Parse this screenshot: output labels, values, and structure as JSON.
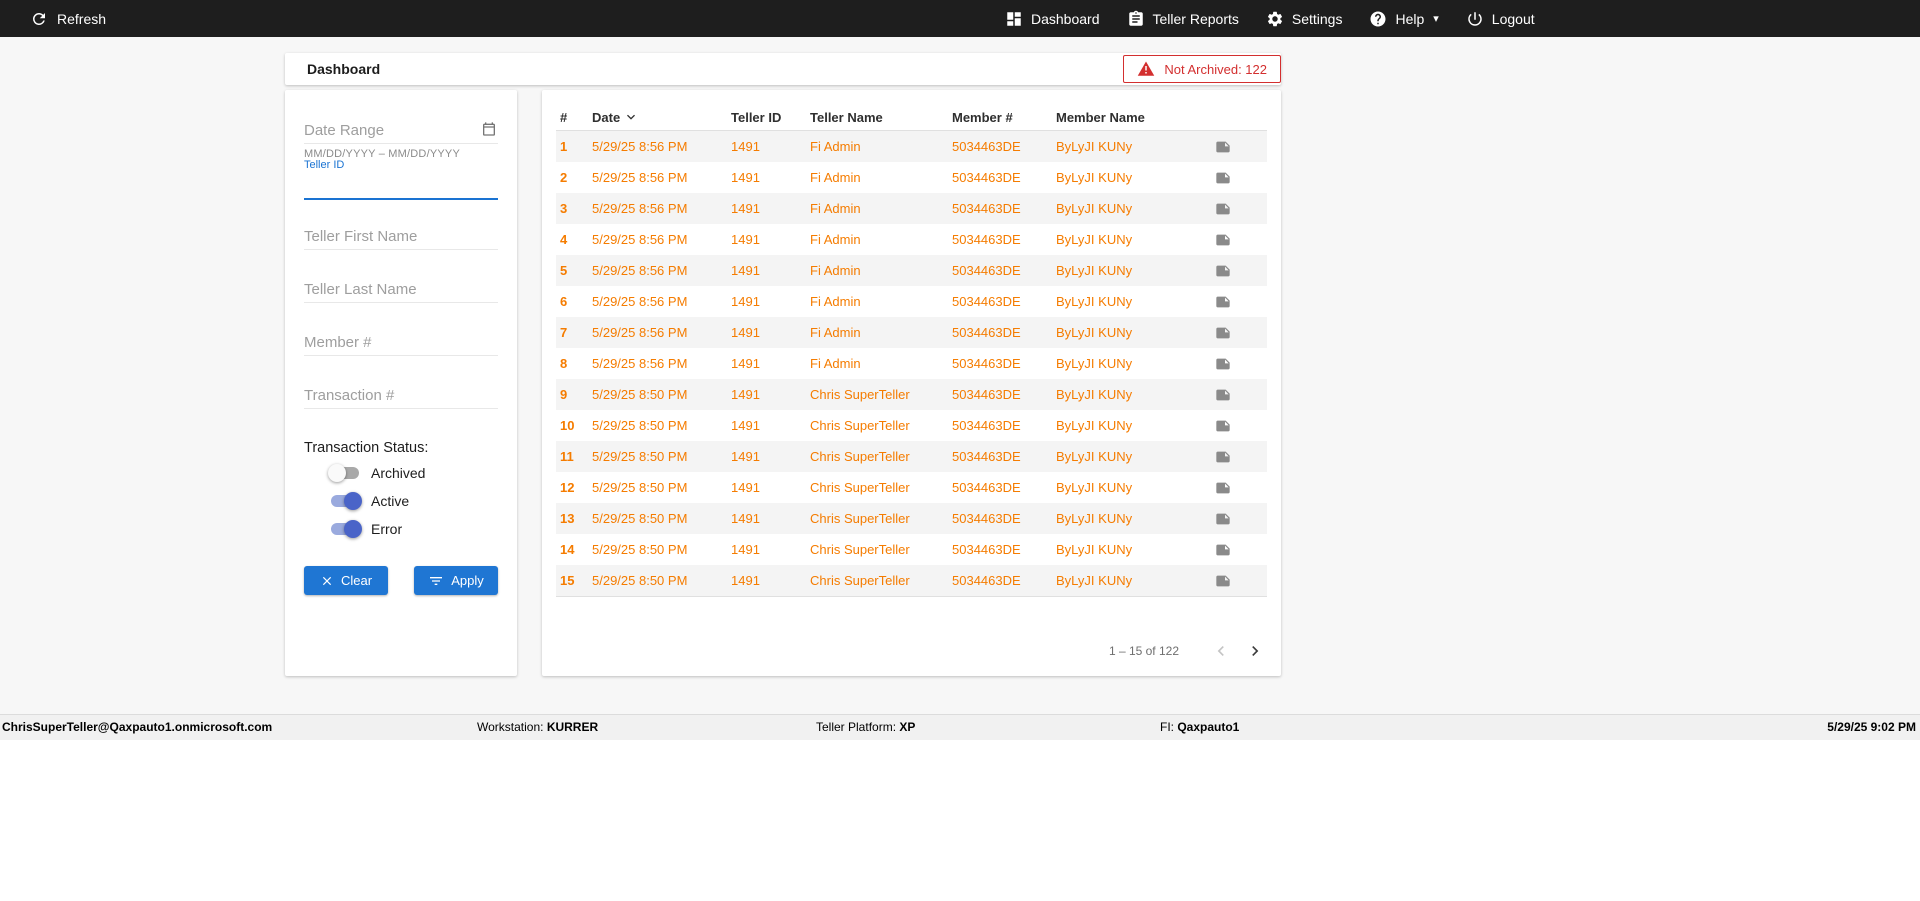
{
  "colors": {
    "topbar_bg": "#1e1e1e",
    "accent_blue": "#1f76d3",
    "row_orange": "#f57c00",
    "alert_red": "#d32f2f",
    "toggle_on_blue": "#4a64c8"
  },
  "topbar": {
    "refresh_label": "Refresh",
    "dashboard_label": "Dashboard",
    "teller_reports_label": "Teller Reports",
    "settings_label": "Settings",
    "help_label": "Help",
    "help_caret": "▾",
    "logout_label": "Logout"
  },
  "header": {
    "title": "Dashboard",
    "not_archived_badge": "Not Archived: 122"
  },
  "filters": {
    "date_range_placeholder": "Date Range",
    "date_range_hint": "MM/DD/YYYY – MM/DD/YYYY",
    "teller_id_label": "Teller ID",
    "teller_first_name_placeholder": "Teller First Name",
    "teller_last_name_placeholder": "Teller Last Name",
    "member_placeholder": "Member #",
    "transaction_placeholder": "Transaction #",
    "status_label": "Transaction Status:",
    "toggles": [
      {
        "label": "Archived",
        "on": false
      },
      {
        "label": "Active",
        "on": true
      },
      {
        "label": "Error",
        "on": true
      }
    ],
    "clear_label": "Clear",
    "apply_label": "Apply"
  },
  "table": {
    "columns": [
      "#",
      "Date",
      "Teller ID",
      "Teller Name",
      "Member #",
      "Member Name"
    ],
    "rows": [
      {
        "n": "1",
        "date": "5/29/25 8:56 PM",
        "teller_id": "1491",
        "teller_name": "Fi Admin",
        "member": "5034463DE",
        "member_name": "ByLyJI KUNy"
      },
      {
        "n": "2",
        "date": "5/29/25 8:56 PM",
        "teller_id": "1491",
        "teller_name": "Fi Admin",
        "member": "5034463DE",
        "member_name": "ByLyJI KUNy"
      },
      {
        "n": "3",
        "date": "5/29/25 8:56 PM",
        "teller_id": "1491",
        "teller_name": "Fi Admin",
        "member": "5034463DE",
        "member_name": "ByLyJI KUNy"
      },
      {
        "n": "4",
        "date": "5/29/25 8:56 PM",
        "teller_id": "1491",
        "teller_name": "Fi Admin",
        "member": "5034463DE",
        "member_name": "ByLyJI KUNy"
      },
      {
        "n": "5",
        "date": "5/29/25 8:56 PM",
        "teller_id": "1491",
        "teller_name": "Fi Admin",
        "member": "5034463DE",
        "member_name": "ByLyJI KUNy"
      },
      {
        "n": "6",
        "date": "5/29/25 8:56 PM",
        "teller_id": "1491",
        "teller_name": "Fi Admin",
        "member": "5034463DE",
        "member_name": "ByLyJI KUNy"
      },
      {
        "n": "7",
        "date": "5/29/25 8:56 PM",
        "teller_id": "1491",
        "teller_name": "Fi Admin",
        "member": "5034463DE",
        "member_name": "ByLyJI KUNy"
      },
      {
        "n": "8",
        "date": "5/29/25 8:56 PM",
        "teller_id": "1491",
        "teller_name": "Fi Admin",
        "member": "5034463DE",
        "member_name": "ByLyJI KUNy"
      },
      {
        "n": "9",
        "date": "5/29/25 8:50 PM",
        "teller_id": "1491",
        "teller_name": "Chris SuperTeller",
        "member": "5034463DE",
        "member_name": "ByLyJI KUNy"
      },
      {
        "n": "10",
        "date": "5/29/25 8:50 PM",
        "teller_id": "1491",
        "teller_name": "Chris SuperTeller",
        "member": "5034463DE",
        "member_name": "ByLyJI KUNy"
      },
      {
        "n": "11",
        "date": "5/29/25 8:50 PM",
        "teller_id": "1491",
        "teller_name": "Chris SuperTeller",
        "member": "5034463DE",
        "member_name": "ByLyJI KUNy"
      },
      {
        "n": "12",
        "date": "5/29/25 8:50 PM",
        "teller_id": "1491",
        "teller_name": "Chris SuperTeller",
        "member": "5034463DE",
        "member_name": "ByLyJI KUNy"
      },
      {
        "n": "13",
        "date": "5/29/25 8:50 PM",
        "teller_id": "1491",
        "teller_name": "Chris SuperTeller",
        "member": "5034463DE",
        "member_name": "ByLyJI KUNy"
      },
      {
        "n": "14",
        "date": "5/29/25 8:50 PM",
        "teller_id": "1491",
        "teller_name": "Chris SuperTeller",
        "member": "5034463DE",
        "member_name": "ByLyJI KUNy"
      },
      {
        "n": "15",
        "date": "5/29/25 8:50 PM",
        "teller_id": "1491",
        "teller_name": "Chris SuperTeller",
        "member": "5034463DE",
        "member_name": "ByLyJI KUNy"
      }
    ],
    "pagination_range": "1 – 15 of 122"
  },
  "footer": {
    "user": "ChrisSuperTeller@Qaxpauto1.onmicrosoft.com",
    "workstation_label": "Workstation:",
    "workstation_value": "KURRER",
    "platform_label": "Teller Platform:",
    "platform_value": "XP",
    "fi_label": "FI:",
    "fi_value": "Qaxpauto1",
    "datetime": "5/29/25 9:02 PM"
  }
}
